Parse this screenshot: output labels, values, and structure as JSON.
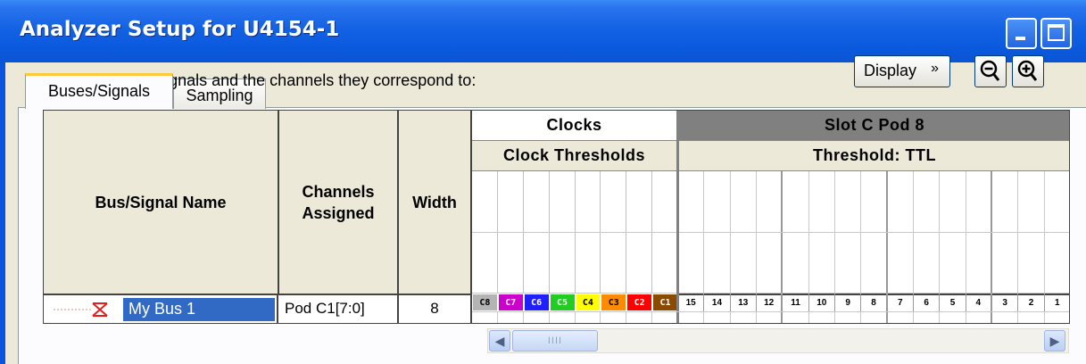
{
  "window": {
    "title": "Analyzer Setup for U4154-1"
  },
  "tabs": [
    {
      "label": "Buses/Signals",
      "active": true
    },
    {
      "label": "Sampling",
      "active": false
    }
  ],
  "instructions": "Enter buses and signals and the channels they correspond to:",
  "toolbar": {
    "display_label": "Display",
    "display_chevron": "»"
  },
  "grid": {
    "headers": {
      "name": "Bus/Signal Name",
      "channels": "Channels Assigned",
      "width": "Width"
    },
    "clocks_title": "Clocks",
    "clock_thresholds_title": "Clock Thresholds",
    "pod_title": "Slot C Pod 8",
    "threshold_title": "Threshold: TTL",
    "clocks": [
      {
        "label": "C8",
        "bg": "#b4b4b4",
        "fg": "#000000"
      },
      {
        "label": "C7",
        "bg": "#cc00cc",
        "fg": "#ffffff"
      },
      {
        "label": "C6",
        "bg": "#2020ff",
        "fg": "#ffffff"
      },
      {
        "label": "C5",
        "bg": "#22cc22",
        "fg": "#ffffff"
      },
      {
        "label": "C4",
        "bg": "#ffff00",
        "fg": "#000000"
      },
      {
        "label": "C3",
        "bg": "#ff8c00",
        "fg": "#000000"
      },
      {
        "label": "C2",
        "bg": "#ff0000",
        "fg": "#ffffff"
      },
      {
        "label": "C1",
        "bg": "#8b4a00",
        "fg": "#ffffff"
      }
    ],
    "bits": [
      "15",
      "14",
      "13",
      "12",
      "11",
      "10",
      "9",
      "8",
      "7",
      "6",
      "5",
      "4",
      "3",
      "2",
      "1"
    ],
    "rows": [
      {
        "name": "My Bus 1",
        "channels": "Pod C1[7:0]",
        "width": "8"
      }
    ]
  },
  "colors": {
    "title_bar": "#0a58dc",
    "selection": "#316ac5",
    "pod_header": "#808080",
    "tab_accent": "#ffc83c"
  },
  "scrollbar": {
    "thumb_grip": "IIII",
    "left_icon": "◀",
    "right_icon": "▶"
  }
}
